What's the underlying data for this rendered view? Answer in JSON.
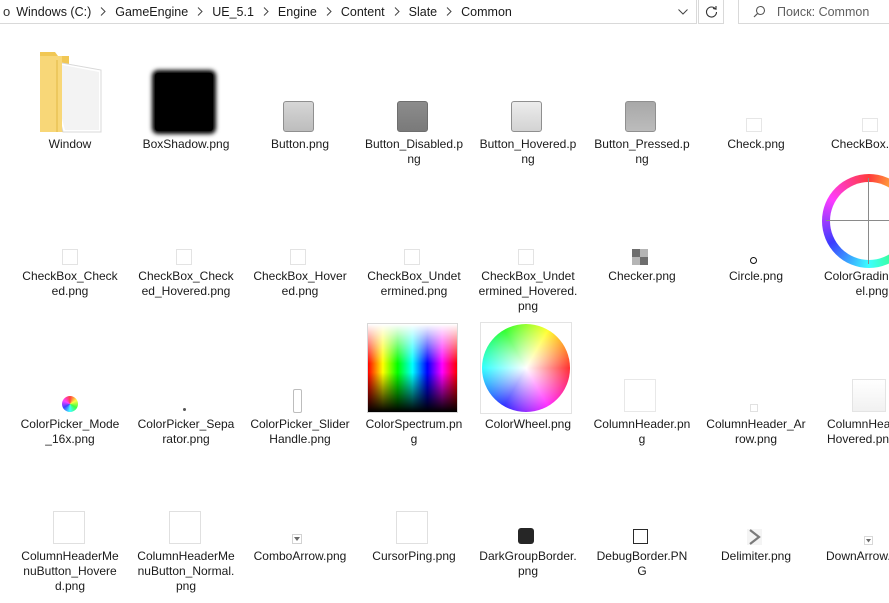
{
  "addressbar": {
    "lead": "o",
    "crumbs": [
      "Windows (C:)",
      "GameEngine",
      "UE_5.1",
      "Engine",
      "Content",
      "Slate",
      "Common"
    ]
  },
  "search": {
    "placeholder": "Поиск: Common"
  },
  "icons": {
    "chevron": "chevron-right-icon",
    "dropdown": "chevron-down-icon",
    "refresh": "refresh-icon",
    "search": "search-icon",
    "folder": "folder-icon"
  },
  "colors": {
    "folder": "#f6d46c",
    "selection": "#cce8ff"
  },
  "files": [
    {
      "label": "Window"
    },
    {
      "label": "BoxShadow.png"
    },
    {
      "label": "Button.png"
    },
    {
      "label": "Button_Disabled.png"
    },
    {
      "label": "Button_Hovered.png"
    },
    {
      "label": "Button_Pressed.png"
    },
    {
      "label": "Check.png"
    },
    {
      "label": "CheckBox.png"
    },
    {
      "label": "CheckBox_Checked.png"
    },
    {
      "label": "CheckBox_Checked_Hovered.png"
    },
    {
      "label": "CheckBox_Hovered.png"
    },
    {
      "label": "CheckBox_Undetermined.png"
    },
    {
      "label": "CheckBox_Undetermined_Hovered.png"
    },
    {
      "label": "Checker.png"
    },
    {
      "label": "Circle.png"
    },
    {
      "label": "ColorGradingWheel.png"
    },
    {
      "label": "ColorPicker_Mode_16x.png"
    },
    {
      "label": "ColorPicker_Separator.png"
    },
    {
      "label": "ColorPicker_SliderHandle.png"
    },
    {
      "label": "ColorSpectrum.png"
    },
    {
      "label": "ColorWheel.png"
    },
    {
      "label": "ColumnHeader.png"
    },
    {
      "label": "ColumnHeader_Arrow.png"
    },
    {
      "label": "ColumnHeader_Hovered.png"
    },
    {
      "label": "ColumnHeaderMenuButton_Hovered.png"
    },
    {
      "label": "ColumnHeaderMenuButton_Normal.png"
    },
    {
      "label": "ComboArrow.png"
    },
    {
      "label": "CursorPing.png"
    },
    {
      "label": "DarkGroupBorder.png"
    },
    {
      "label": "DebugBorder.PNG"
    },
    {
      "label": "Delimiter.png"
    },
    {
      "label": "DownArrow.png"
    }
  ]
}
